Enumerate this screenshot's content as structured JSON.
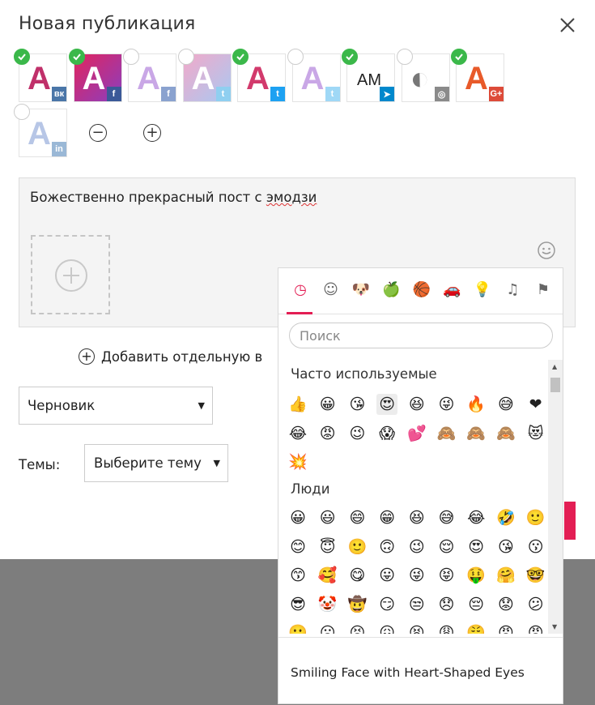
{
  "dialog": {
    "title": "Новая публикация",
    "close_icon": "close-icon"
  },
  "accounts": [
    {
      "id": "vk",
      "logo": "A",
      "badge": "вк",
      "badge_color": "#4a76a8",
      "selected": true
    },
    {
      "id": "fb-page",
      "logo": "A",
      "badge": "f",
      "badge_color": "#3b5998",
      "selected": true
    },
    {
      "id": "fb-2",
      "logo": "A",
      "badge": "f",
      "badge_color": "#8aa2cf",
      "selected": false
    },
    {
      "id": "tw-1",
      "logo": "A",
      "badge": "t",
      "badge_color": "#8fcff0",
      "selected": false
    },
    {
      "id": "tw-2",
      "logo": "A",
      "badge": "t",
      "badge_color": "#1da1f2",
      "selected": true
    },
    {
      "id": "tw-3",
      "logo": "A",
      "badge": "t",
      "badge_color": "#9fd8f6",
      "selected": false
    },
    {
      "id": "tg",
      "logo": "AM",
      "badge": "➤",
      "badge_color": "#0088cc",
      "selected": true
    },
    {
      "id": "ig",
      "logo": "◐",
      "badge": "◎",
      "badge_color": "#8a8a8a",
      "selected": false
    },
    {
      "id": "gplus",
      "logo": "A",
      "badge": "G+",
      "badge_color": "#dd4b39",
      "selected": true
    },
    {
      "id": "in",
      "logo": "A",
      "badge": "in",
      "badge_color": "#9ab8d6",
      "selected": false
    }
  ],
  "controls": {
    "minus": "−",
    "plus": "+"
  },
  "editor": {
    "text_prefix": "Божественно прекрасный пост с ",
    "text_misspelled": "эмодзи"
  },
  "add_row": {
    "label": "Добавить отдельную в"
  },
  "status_select": {
    "value": "Черновик"
  },
  "topics": {
    "label": "Темы:",
    "placeholder": "Выберите тему"
  },
  "picker": {
    "categories": [
      {
        "name": "recent-icon",
        "glyph": "◷",
        "active": true
      },
      {
        "name": "smiley-icon",
        "glyph": "☺"
      },
      {
        "name": "animal-icon",
        "glyph": "🐶"
      },
      {
        "name": "food-icon",
        "glyph": "🍏"
      },
      {
        "name": "sport-icon",
        "glyph": "🏀"
      },
      {
        "name": "car-icon",
        "glyph": "🚗"
      },
      {
        "name": "bulb-icon",
        "glyph": "💡"
      },
      {
        "name": "symbols-icon",
        "glyph": "♫"
      },
      {
        "name": "flag-icon",
        "glyph": "⚑"
      }
    ],
    "search_placeholder": "Поиск",
    "section_frequent": "Часто используемые",
    "frequent": [
      "👍",
      "😀",
      "😘",
      "😍",
      "😆",
      "😜",
      "🔥",
      "😅",
      "❤",
      "😂",
      "😡",
      "😉",
      "😱",
      "💕",
      "🙈",
      "🙈",
      "🙈",
      "😻",
      "💥"
    ],
    "section_people": "Люди",
    "people": [
      "😀",
      "😃",
      "😄",
      "😁",
      "😆",
      "😅",
      "😂",
      "🤣",
      "🙂",
      "😊",
      "😇",
      "🙂",
      "🙃",
      "😉",
      "😌",
      "😍",
      "😘",
      "😗",
      "😙",
      "🥰",
      "😋",
      "😛",
      "😜",
      "😝",
      "🤑",
      "🤗",
      "🤓",
      "😎",
      "🤡",
      "🤠",
      "😏",
      "😒",
      "😞",
      "😔",
      "😟",
      "😕",
      "🙁",
      "☹",
      "😣",
      "😖",
      "😫",
      "😩",
      "😤",
      "😠",
      "😡"
    ],
    "selected_name": "Smiling Face with Heart-Shaped Eyes"
  }
}
